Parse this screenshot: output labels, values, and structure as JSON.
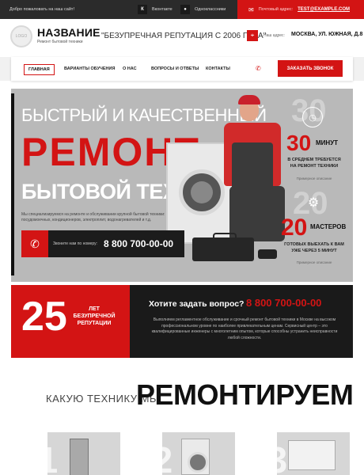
{
  "topbar": {
    "welcome": "Добро пожаловать на наш сайт!",
    "social": [
      {
        "icon": "vk-icon",
        "label": "Вконтакте"
      },
      {
        "icon": "ok-icon",
        "label": "Одноклассники"
      }
    ],
    "email_label": "Почтовый адрес:",
    "email": "TEST@EXAMPLE.COM"
  },
  "header": {
    "logo_text": "LOGO",
    "brand_name": "НАЗВАНИЕ",
    "brand_sub": "Ремонт бытовой техники",
    "slogan": "\"БЕЗУПРЕЧНАЯ РЕПУТАЦИЯ С 2006 ГОДА\"",
    "address_label": "Наш адрес:",
    "address": "МОСКВА, УЛ. ЮЖНАЯ, Д.8"
  },
  "nav": {
    "items": [
      "ГЛАВНАЯ",
      "ВАРИАНТЫ ОБУЧЕНИЯ",
      "О НАС",
      "ВОПРОСЫ И ОТВЕТЫ",
      "КОНТАКТЫ"
    ],
    "call_button": "ЗАКАЗАТЬ ЗВОНОК"
  },
  "hero": {
    "line1": "БЫСТРЫЙ И КАЧЕСТВЕННЫЙ",
    "line2": "РЕМОНТ",
    "line3": "БЫТОВОЙ ТЕХНИКИ",
    "description": "Мы специализируемся на ремонте и обслуживании крупной бытовой техники: стиральных машин, холодильников, посудомоечных, кондиционеров, электроплит, водонагревателей и т.д.",
    "call_text": "Звоните нам по номеру:",
    "phone": "8 800 700-00-00",
    "stat1": {
      "ghost": "30",
      "value": "30",
      "unit": "МИНУТ",
      "desc": "В СРЕДНЕМ ТРЕБУЕТСЯ НА РЕМОНТ ТЕХНИКИ",
      "note": "Примерное описание"
    },
    "stat2": {
      "ghost": "20",
      "value": "20",
      "unit": "МАСТЕРОВ",
      "desc": "ГОТОВЫХ ВЫЕХАТЬ К ВАМ УЖЕ ЧЕРЕЗ 5 МИНУТ",
      "note": "Примерное описание"
    }
  },
  "promo": {
    "years": "25",
    "years_text": "ЛЕТ БЕЗУПРЕЧНОЙ РЕПУТАЦИИ",
    "question": "Хотите задать вопрос?",
    "phone": "8 800 700-00-00",
    "description": "Выполняем регламентное обслуживание и срочный ремонт бытовой техники в Москве на высоком профессиональном уровне по наиболее привлекательным ценам. Сервисный центр – это квалифицированные инженеры с многолетним опытом, которые способны устранить неисправности любой сложности."
  },
  "section": {
    "title_light": "КАКУЮ ТЕХНИКУ МЫ",
    "title_bold": "РЕМОНТИРУЕМ"
  },
  "cards": [
    {
      "num": "01",
      "icon": "fridge-icon"
    },
    {
      "num": "02",
      "icon": "washing-machine-icon"
    },
    {
      "num": "03",
      "icon": "air-conditioner-icon"
    }
  ],
  "colors": {
    "accent": "#d31414",
    "dark": "#1a1a1a"
  }
}
